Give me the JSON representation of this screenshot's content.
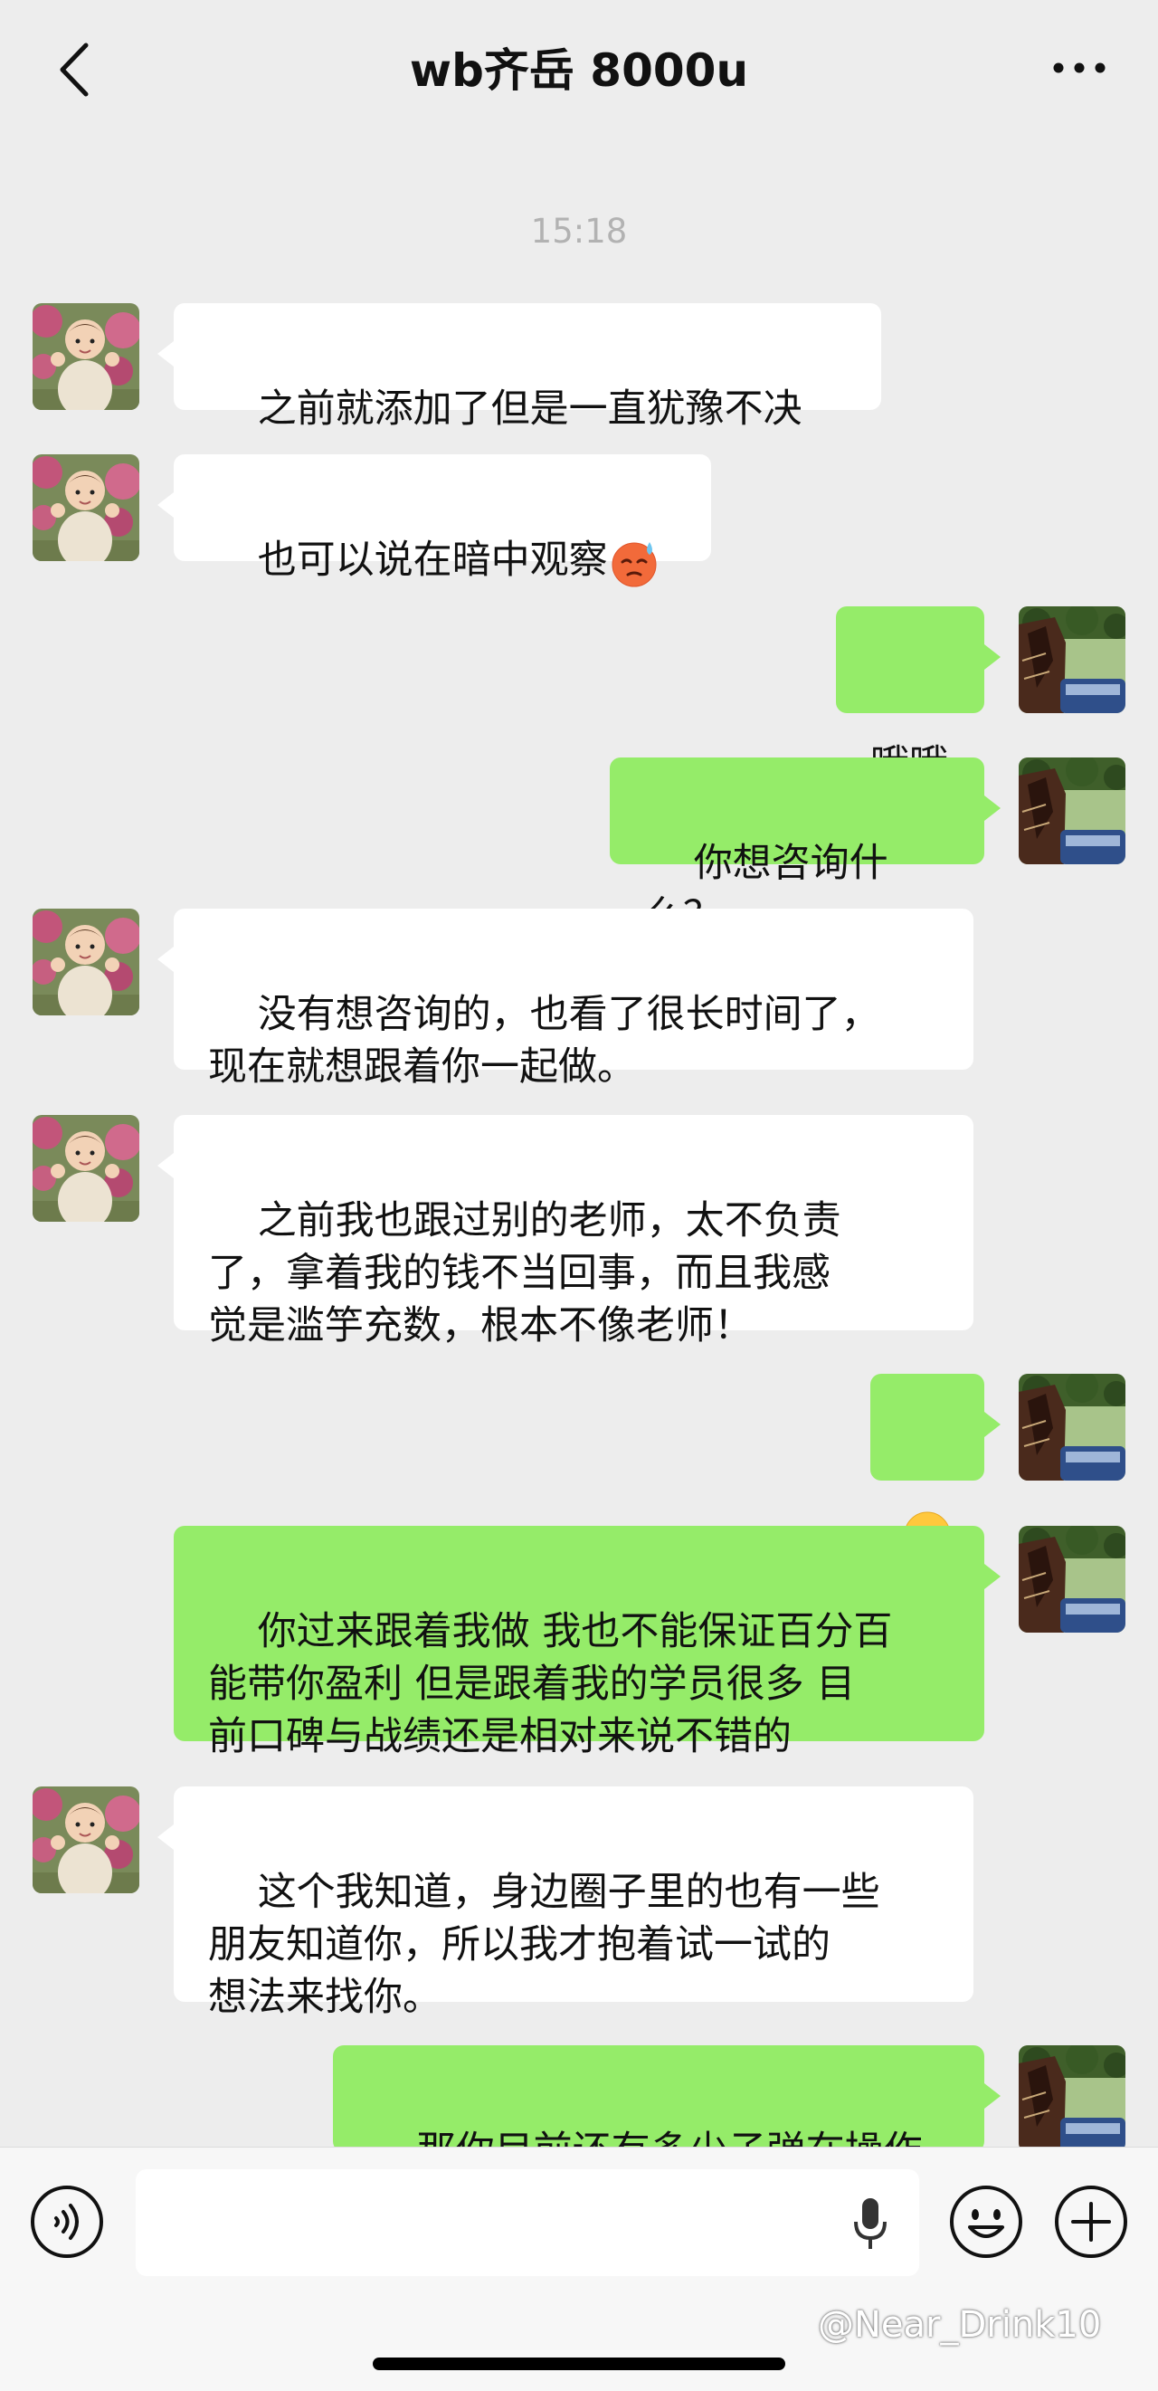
{
  "header": {
    "title": "wb齐岳 8000u",
    "back_icon": "chevron-left-icon",
    "more_icon": "more-dots-icon"
  },
  "chat": {
    "timestamp": "15:18",
    "messages": [
      {
        "side": "in",
        "text": "之前就添加了但是一直犹豫不决"
      },
      {
        "side": "in",
        "text": "也可以说在暗中观察",
        "emoji": "sweat-face-emoji"
      },
      {
        "side": "out",
        "text": "哦哦"
      },
      {
        "side": "out",
        "text": "你想咨询什么？"
      },
      {
        "side": "in",
        "text": "没有想咨询的，也看了很长时间了，\n现在就想跟着你一起做。"
      },
      {
        "side": "in",
        "text": "之前我也跟过别的老师，太不负责\n了，拿着我的钱不当回事，而且我感\n觉是滥竽充数，根本不像老师！"
      },
      {
        "side": "out",
        "text": "",
        "emoji": "laugh-cry-emoji"
      },
      {
        "side": "out",
        "text": "你过来跟着我做 我也不能保证百分百\n能带你盈利 但是跟着我的学员很多 目\n前口碑与战绩还是相对来说不错的"
      },
      {
        "side": "in",
        "text": "这个我知道，身边圈子里的也有一些\n朋友知道你，所以我才抱着试一试的\n想法来找你。"
      },
      {
        "side": "out",
        "text": "那你目前还有多少子弹在操作"
      }
    ]
  },
  "input_bar": {
    "voice_icon": "voice-icon",
    "mic_icon": "microphone-icon",
    "emoji_icon": "smiley-icon",
    "plus_icon": "plus-icon",
    "input_value": ""
  },
  "watermark": "@Near_Drink10",
  "colors": {
    "background": "#ededed",
    "incoming_bubble": "#ffffff",
    "outgoing_bubble": "#95ec69",
    "timestamp": "#b2b2b2"
  }
}
